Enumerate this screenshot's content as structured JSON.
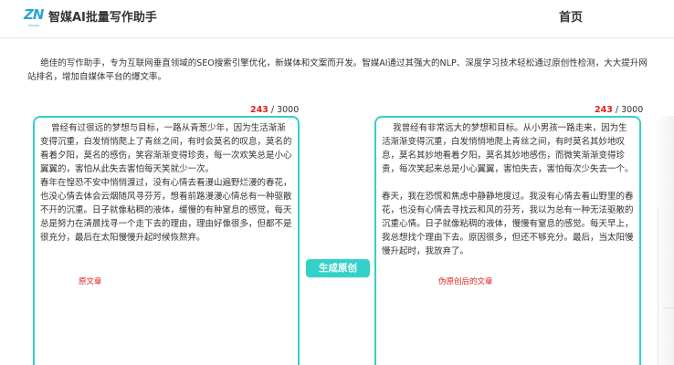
{
  "header": {
    "logo_mark": "ZN",
    "logo_sub": "chinaz",
    "app_title": "智媒AI批量写作助手",
    "nav_home": "首页"
  },
  "intro": {
    "text": "绝佳的写作助手，专为互联网垂直领域的SEO搜索引擎优化，新媒体和文案而开发。智媒AI通过其强大的NLP、深度学习技术轻松通过原创性检测，大大提升网站排名，增加自媒体平台的爆文率。"
  },
  "left_panel": {
    "count": "243",
    "max": "3000",
    "text": "    曾经有过很远的梦想与目标，一路从青葱少年，因为生活渐渐变得沉重，白发悄悄爬上了青丝之间，有时会莫名的叹息，莫名的看着夕阳，莫名的感伤，笑容渐渐变得珍贵，每一次欢笑总是小心翼翼的，害怕从此失去害怕每天笑就少一次。\n春年在惶恐不安中悄悄渡过，没有心情去看漫山遍野烂漫的春花，也没心情去体会云烟随风寻芬芳，想看前路漫漫心情总有一种驱散不开的沉重。日子就像粘稠的液体，缓慢的有种窒息的感觉，每天总是努力在清晨找寻一个走下去的理由，理由好像很多，但都不是很充分，最后在太阳慢慢升起时候恢熬弃。",
    "label": "原文章"
  },
  "right_panel": {
    "count": "243",
    "max": "3000",
    "text": "    我曾经有非常远大的梦想和目标。从小男孩一路走来，因为生活渐渐变得沉重，白发悄悄地爬上青丝之间，有时莫名其妙地叹息，莫名其妙地看着夕阳，莫名其妙地感伤，而微笑渐渐变得珍贵，每次笑起来总是小心翼翼，害怕失去，害怕每次少失去一个。\n\n春天，我在恐慌和焦虑中静静地度过。我没有心情去看山野里的春花，也没有心情去寻找云和风的芬芳，我以为总有一种无法驱散的沉重心情。日子就像粘稠的液体，慢慢有窒息的感觉。每天早上，我总想找个理由下去。原因很多，但还不够充分。最后，当太阳慢慢升起时，我放弃了。",
    "label": "伪原创后的文章"
  },
  "generate_button": {
    "label": "生成原创"
  },
  "colors": {
    "accent": "#33d1c9",
    "count_red": "#e02020",
    "logo_blue": "#2aa5d6"
  }
}
